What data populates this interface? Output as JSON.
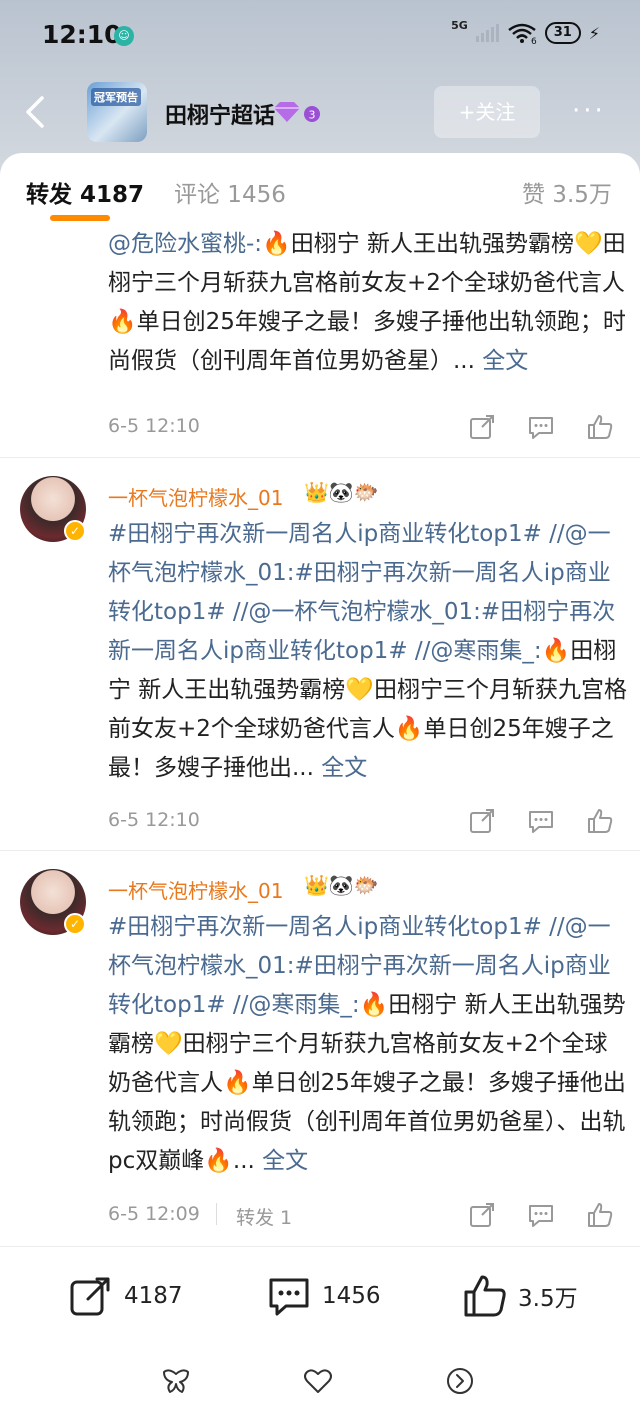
{
  "status_bar": {
    "time": "12:10",
    "network": "5G",
    "wifi_sub": "6",
    "battery": "31"
  },
  "nav": {
    "topic_title": "田栩宁超话",
    "topic_thumb_text": "冠军预告",
    "level": "3",
    "follow_label": "+关注",
    "more_label": "···"
  },
  "tabs": [
    {
      "label": "转发 4187",
      "active": true
    },
    {
      "label": "评论 1456",
      "active": false
    },
    {
      "label": "赞 3.5万",
      "active": false
    }
  ],
  "items": [
    {
      "username": "",
      "emojis": "",
      "text_link": "@危险水蜜桃-:",
      "text_body": "🔥田栩宁 新人王出轨强势霸榜💛田栩宁三个月斩获九宫格前女友+2个全球奶爸代言人🔥单日创25年嫂子之最！多嫂子捶他出轨领跑；时尚假货（创刊周年首位男奶爸星）... ",
      "full_label": "全文",
      "time": "6-5 12:10",
      "repost": ""
    },
    {
      "username": "一杯气泡柠檬水_01",
      "emojis": "👑🐼🐡",
      "text_link": "#田栩宁再次新一周名人ip商业转化top1# //@一杯气泡柠檬水_01:#田栩宁再次新一周名人ip商业转化top1# //@一杯气泡柠檬水_01:#田栩宁再次新一周名人ip商业转化top1# //@寒雨集_:",
      "text_body": "🔥田栩宁 新人王出轨强势霸榜💛田栩宁三个月斩获九宫格前女友+2个全球奶爸代言人🔥单日创25年嫂子之最！多嫂子捶他出... ",
      "full_label": "全文",
      "time": "6-5 12:10",
      "repost": ""
    },
    {
      "username": "一杯气泡柠檬水_01",
      "emojis": "👑🐼🐡",
      "text_link": "#田栩宁再次新一周名人ip商业转化top1# //@一杯气泡柠檬水_01:#田栩宁再次新一周名人ip商业转化top1# //@寒雨集_:",
      "text_body": "🔥田栩宁 新人王出轨强势霸榜💛田栩宁三个月斩获九宫格前女友+2个全球奶爸代言人🔥单日创25年嫂子之最！多嫂子捶他出轨领跑；时尚假货（创刊周年首位男奶爸星）、出轨pc双巅峰🔥... ",
      "full_label": "全文",
      "time": "6-5 12:09",
      "repost": "转发 1"
    }
  ],
  "bottom_bar": {
    "repost_count": "4187",
    "comment_count": "1456",
    "like_count": "3.5万"
  }
}
